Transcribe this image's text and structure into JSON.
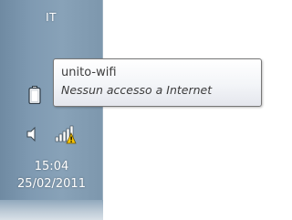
{
  "taskbar": {
    "language_indicator": "IT",
    "clock": {
      "time": "15:04",
      "date": "25/02/2011"
    }
  },
  "tray_icons": [
    "battery-icon",
    "speaker-icon",
    "network-warning-icon"
  ],
  "tooltip": {
    "network_name": "unito-wifi",
    "status": "Nessun accesso a Internet"
  }
}
